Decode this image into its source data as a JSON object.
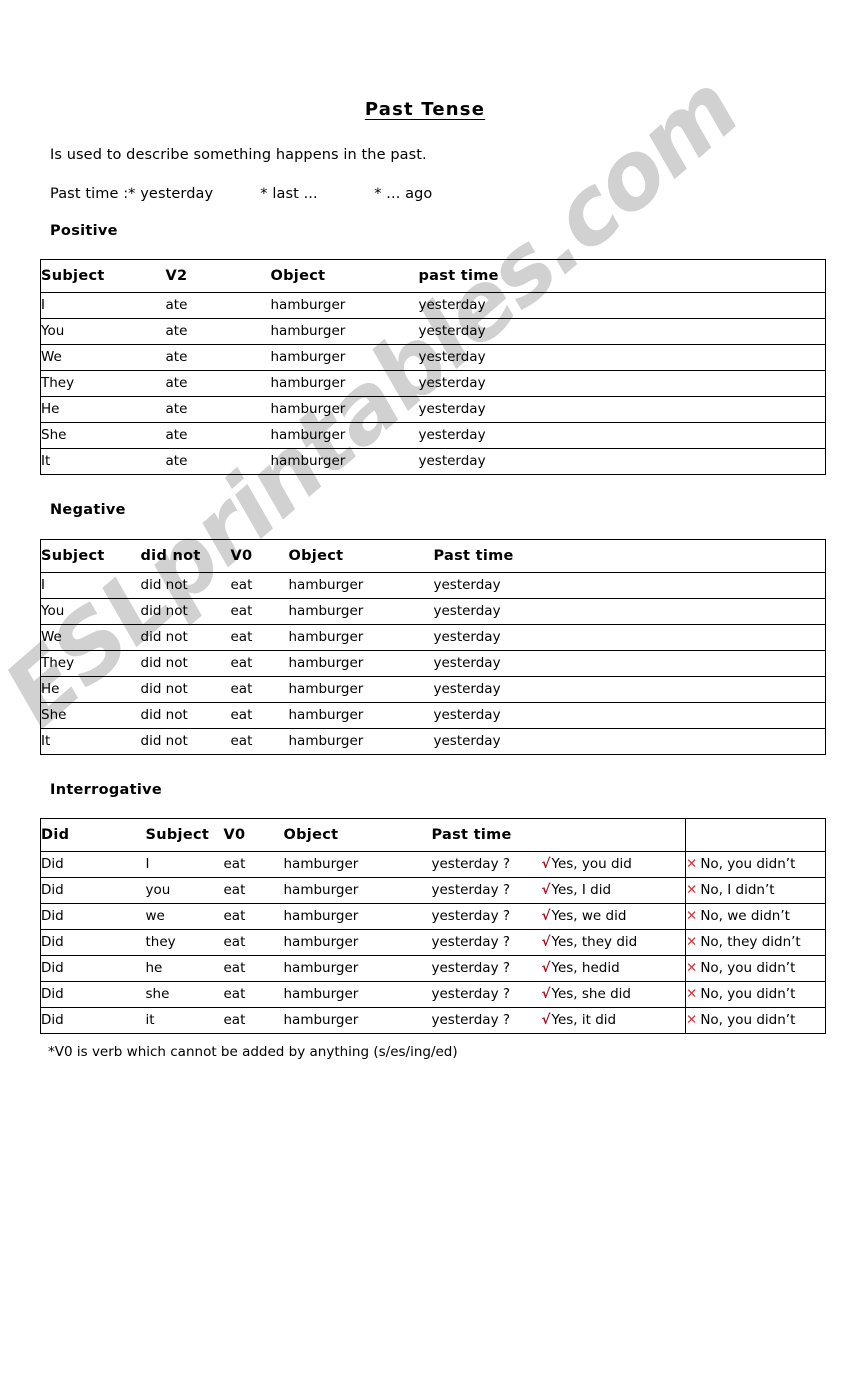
{
  "document": {
    "title": "Past Tense",
    "intro_line": "Is used to describe something happens in the past.",
    "past_time_line": "Past time :* yesterday          * last ...            * ... ago",
    "footnote": "*V0 is verb which cannot be added by anything (s/es/ing/ed)",
    "watermark": "ESLprintables.com",
    "colors": {
      "check_mark": "#a01020",
      "cross_mark": "#d4383f",
      "text": "#000000",
      "watermark": "#c9c9c9",
      "border": "#000000"
    }
  },
  "sections": {
    "positive": {
      "heading": "Positive",
      "headers": [
        "Subject",
        "V2",
        "Object",
        "past time"
      ],
      "rows": [
        [
          "I",
          "ate",
          "hamburger",
          "yesterday"
        ],
        [
          "You",
          "ate",
          "hamburger",
          "yesterday"
        ],
        [
          "We",
          "ate",
          "hamburger",
          "yesterday"
        ],
        [
          "They",
          "ate",
          "hamburger",
          "yesterday"
        ],
        [
          "He",
          "ate",
          "hamburger",
          "yesterday"
        ],
        [
          "She",
          "ate",
          "hamburger",
          "yesterday"
        ],
        [
          "It",
          "ate",
          "hamburger",
          "yesterday"
        ]
      ]
    },
    "negative": {
      "heading": "Negative",
      "headers": [
        "Subject",
        "did not",
        "V0",
        "Object",
        "Past time"
      ],
      "rows": [
        [
          "I",
          "did not",
          "eat",
          "hamburger",
          "yesterday"
        ],
        [
          "You",
          "did not",
          "eat",
          "hamburger",
          "yesterday"
        ],
        [
          "We",
          "did not",
          "eat",
          "hamburger",
          "yesterday"
        ],
        [
          "They",
          "did not",
          "eat",
          "hamburger",
          "yesterday"
        ],
        [
          "He",
          "did not",
          "eat",
          "hamburger",
          "yesterday"
        ],
        [
          "She",
          "did not",
          "eat",
          "hamburger",
          "yesterday"
        ],
        [
          "It",
          "did not",
          "eat",
          "hamburger",
          "yesterday"
        ]
      ]
    },
    "interrogative": {
      "heading": "Interrogative",
      "headers": [
        "Did",
        "Subject",
        "V0",
        "Object",
        "Past time",
        "",
        ""
      ],
      "check_glyph": "√",
      "cross_glyph": "✕",
      "rows": [
        [
          "Did",
          "I",
          "eat",
          "hamburger",
          "yesterday ?",
          "Yes, you did",
          "No, you didn’t"
        ],
        [
          "Did",
          "you",
          "eat",
          "hamburger",
          "yesterday ?",
          "Yes, I did",
          "No, I didn’t"
        ],
        [
          "Did",
          "we",
          "eat",
          "hamburger",
          "yesterday ?",
          "Yes, we did",
          "No, we didn’t"
        ],
        [
          "Did",
          "they",
          "eat",
          "hamburger",
          "yesterday ?",
          "Yes, they did",
          "No, they didn’t"
        ],
        [
          "Did",
          "he",
          "eat",
          "hamburger",
          "yesterday ?",
          "Yes, hedid",
          "No, you didn’t"
        ],
        [
          "Did",
          "she",
          "eat",
          "hamburger",
          "yesterday ?",
          "Yes, she did",
          "No, you didn’t"
        ],
        [
          "Did",
          "it",
          "eat",
          "hamburger",
          "yesterday ?",
          "Yes, it did",
          "No, you didn’t"
        ]
      ]
    }
  }
}
